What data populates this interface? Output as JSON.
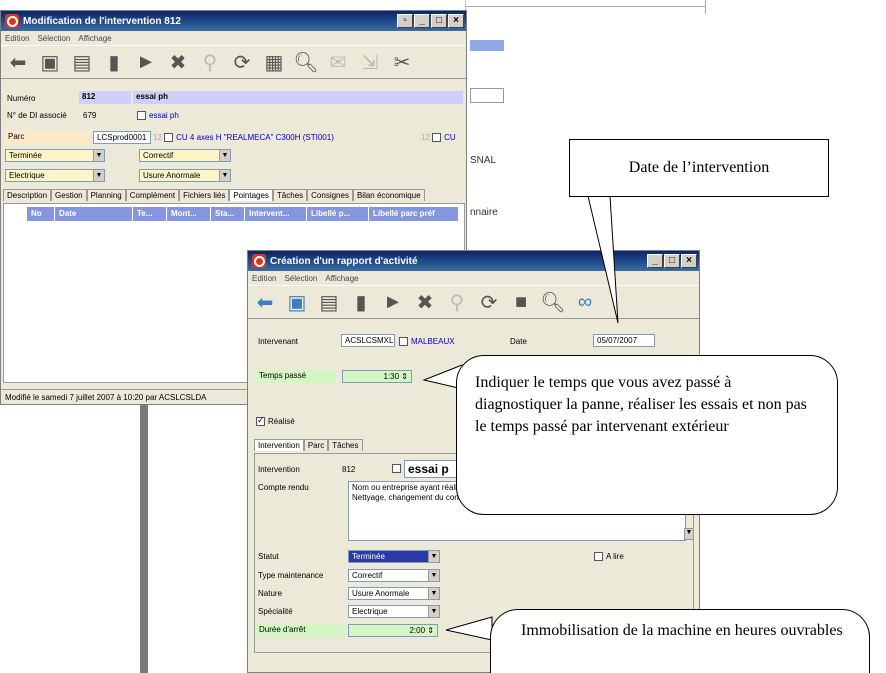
{
  "win1": {
    "title": "Modification de l'intervention 812",
    "menu": [
      "Edition",
      "Sélection",
      "Affichage"
    ],
    "numero_label": "Numéro",
    "numero_value": "812",
    "numero_desc": "essai ph",
    "di_label": "N° de DI associé",
    "di_value": "679",
    "di_desc": "essai ph",
    "parc_label": "Parc",
    "parc_code": "LCSprod0001",
    "parc_desc": "CU 4 axes H \"REALMECA\" C300H (STI001)",
    "status": "Terminée",
    "type": "Correctif",
    "specialite": "Electrique",
    "nature": "Usure Anormale",
    "tabs": [
      "Description",
      "Gestion",
      "Planning",
      "Complément",
      "Fichiers liés",
      "Pointages",
      "Tâches",
      "Consignes",
      "Bilan économique"
    ],
    "columns": [
      "No",
      "Date",
      "Te...",
      "Mont...",
      "Sta...",
      "Intervent...",
      "Libellé p...",
      "Libellé parc préf"
    ],
    "status_text": "Modifié le samedi 7 juillet 2007 à 10:20 par ACSLCSLDA",
    "side_fragment": "CU",
    "side_num": "12"
  },
  "bg": {
    "text1": "SNAL",
    "text2": "nnaire"
  },
  "win2": {
    "title": "Création d'un rapport d'activité",
    "menu": [
      "Edition",
      "Sélection",
      "Affichage"
    ],
    "intervenant_label": "Intervenant",
    "intervenant_code": "ACSLCSMXL",
    "intervenant_name": "MALBEAUX",
    "date_label": "Date",
    "date_value": "05/07/2007",
    "temps_label": "Temps passé",
    "temps_value": "1:30",
    "realise_label": "Réalisé",
    "tabs": [
      "Intervention",
      "Parc",
      "Tâches"
    ],
    "intervention_label": "Intervention",
    "intervention_value": "812",
    "intervention_desc": "essai p",
    "compte_label": "Compte rendu",
    "compte_line1": "Nom ou entreprise ayant réalisé",
    "compte_line2": "Nettyage, changement du contac",
    "statut_label": "Statut",
    "statut_value": "Terminée",
    "type_label": "Type maintenance",
    "type_value": "Correctif",
    "nature_label": "Nature",
    "nature_value": "Usure Anormale",
    "specialite_label": "Spécialité",
    "specialite_value": "Electrique",
    "alire_label": "A lire",
    "duree_label": "Durée d'arrêt",
    "duree_value": "2:00"
  },
  "callouts": {
    "date": "Date de l’intervention",
    "temps": "Indiquer le temps que vous avez passé à diagnostiquer la panne, réaliser les essais et non pas le temps passé par intervenant extérieur",
    "immob": "Immobilisation de la machine en heures ouvrables"
  },
  "colors": {
    "title_gradient_start": "#0a246a",
    "grid_header": "#8496e0",
    "field_green": "#d4f5c4",
    "field_orange": "#fde8c8",
    "field_yellow": "#fdf6c8",
    "field_blue": "#cfd0f5"
  }
}
